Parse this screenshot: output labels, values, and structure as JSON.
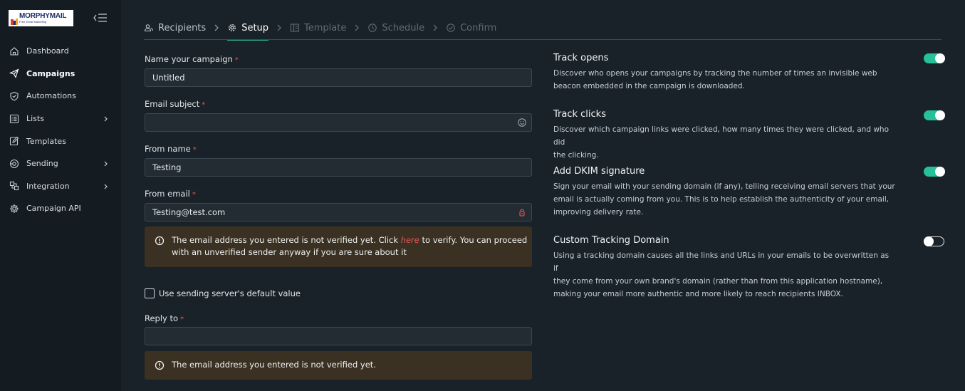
{
  "brand": {
    "logo_title": "MORPHYMAIL",
    "logo_subtitle": "Free Email Marketing",
    "accent_color": "#26c09a",
    "alert_color": "#3b3122",
    "required_color": "#e45757"
  },
  "sidebar": {
    "items": [
      {
        "label": "Dashboard",
        "icon": "home-icon",
        "has_chevron": false
      },
      {
        "label": "Campaigns",
        "icon": "send-icon",
        "has_chevron": false,
        "active": true
      },
      {
        "label": "Automations",
        "icon": "shield-check-icon",
        "has_chevron": false
      },
      {
        "label": "Lists",
        "icon": "list-icon",
        "has_chevron": true
      },
      {
        "label": "Templates",
        "icon": "edit-icon",
        "has_chevron": false
      },
      {
        "label": "Sending",
        "icon": "sending-icon",
        "has_chevron": true
      },
      {
        "label": "Integration",
        "icon": "integration-icon",
        "has_chevron": true
      },
      {
        "label": "Campaign API",
        "icon": "gear-icon",
        "has_chevron": false
      }
    ]
  },
  "steps": [
    {
      "label": "Recipients",
      "icon": "users-icon",
      "state": "done"
    },
    {
      "label": "Setup",
      "icon": "gear-icon",
      "state": "current"
    },
    {
      "label": "Template",
      "icon": "layout-icon",
      "state": "pending"
    },
    {
      "label": "Schedule",
      "icon": "clock-icon",
      "state": "pending"
    },
    {
      "label": "Confirm",
      "icon": "check-circle-icon",
      "state": "pending"
    }
  ],
  "form": {
    "campaign_name": {
      "label": "Name your campaign",
      "required_mark": "*",
      "value": "Untitled"
    },
    "email_subject": {
      "label": "Email subject",
      "required_mark": "*",
      "value": ""
    },
    "from_name": {
      "label": "From name",
      "required_mark": "*",
      "value": "Testing"
    },
    "from_email": {
      "label": "From email",
      "required_mark": "*",
      "value": "Testing@test.com"
    },
    "from_email_alert": {
      "text_before": "The email address you entered is not verified yet. Click ",
      "link": "here",
      "text_after": " to verify. You can proceed",
      "line2": "with an unverified sender anyway if you are sure about it"
    },
    "default_value_checkbox": {
      "label": "Use sending server's default value",
      "checked": false
    },
    "reply_to": {
      "label": "Reply to",
      "required_mark": "*",
      "value": ""
    },
    "reply_to_alert": {
      "text": "The email address you entered is not verified yet."
    }
  },
  "options": [
    {
      "title": "Track opens",
      "enabled": true,
      "desc": [
        "Discover who opens your campaigns by tracking the number of times an invisible web",
        "beacon embedded in the campaign is downloaded."
      ]
    },
    {
      "title": "Track clicks",
      "enabled": true,
      "desc": [
        "Discover which campaign links were clicked, how many times they were clicked, and who did",
        "the clicking."
      ]
    },
    {
      "title": "Add DKIM signature",
      "enabled": true,
      "desc": [
        "Sign your email with your sending domain (if any), telling receiving email servers that your",
        "email is actually coming from you. This is to help establish the authenticity of your email,",
        "improving delivery rate."
      ]
    },
    {
      "title": "Custom Tracking Domain",
      "enabled": false,
      "desc": [
        "Using a tracking domain causes all the links and URLs in your emails to be overwritten as if",
        "they come from your own brand's domain (rather than from this application hostname),",
        "making your email more authentic and more likely to reach recipients INBOX."
      ]
    }
  ]
}
